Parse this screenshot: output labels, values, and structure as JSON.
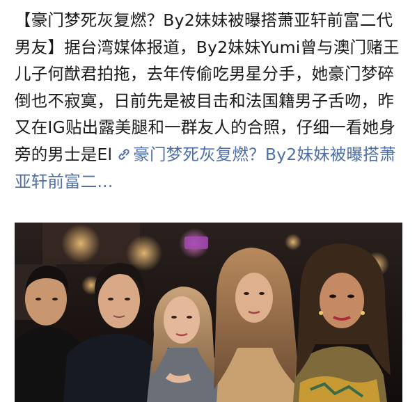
{
  "post": {
    "text": "【豪门梦死灰复燃？By2妹妹被曝搭萧亚轩前富二代男友】据台湾媒体报道，By2妹妹Yumi曾与澳门赌王儿子何猷君拍拖，去年传偷吃男星分手，她豪门梦碎倒也不寂寞，日前先是被目击和法国籍男子舌吻，昨又在IG贴出露美腿和一群友人的合照，仔细一看她身旁的男士是El",
    "link_text": "豪门梦死灰复燃？By2妹妹被曝搭萧亚轩前富二...",
    "link_icon": "link-icon",
    "link_color": "#4f6fa8"
  },
  "photo": {
    "description_icon": "photo-group-image"
  }
}
